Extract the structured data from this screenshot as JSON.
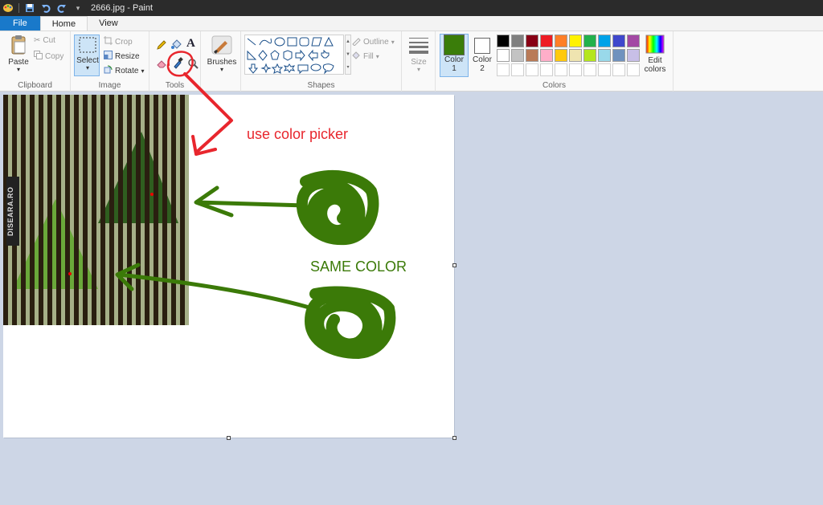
{
  "window": {
    "title": "2666.jpg - Paint"
  },
  "tabs": [
    "File",
    "Home",
    "View"
  ],
  "clipboard": {
    "paste": "Paste",
    "cut": "Cut",
    "copy": "Copy",
    "label": "Clipboard"
  },
  "image": {
    "select": "Select",
    "crop": "Crop",
    "resize": "Resize",
    "rotate": "Rotate",
    "label": "Image"
  },
  "tools": {
    "label": "Tools",
    "text_tool": "A"
  },
  "brushes": {
    "label": "Brushes"
  },
  "shapes": {
    "outline": "Outline",
    "fill": "Fill",
    "label": "Shapes"
  },
  "size": {
    "label": "Size"
  },
  "colors": {
    "color1_label": "Color",
    "color1_num": "1",
    "color2_label": "Color",
    "color2_num": "2",
    "edit_label_1": "Edit",
    "edit_label_2": "colors",
    "label": "Colors",
    "color1_value": "#3a7d0a",
    "color2_value": "#ffffff",
    "row1": [
      "#000000",
      "#7f7f7f",
      "#880015",
      "#ed1c24",
      "#ff7f27",
      "#fff200",
      "#22b14c",
      "#00a2e8",
      "#3f48cc",
      "#a349a4"
    ],
    "row2": [
      "#ffffff",
      "#c3c3c3",
      "#b97a57",
      "#ffaec9",
      "#ffc90e",
      "#efe4b0",
      "#b5e61d",
      "#99d9ea",
      "#7092be",
      "#c8bfe7"
    ]
  },
  "annotations": {
    "color_picker_note": "use color picker",
    "same_color_note": "SAME COLOR",
    "watermark": "DISEARA.RO",
    "red_color": "#e8262d",
    "green_color": "#3b7a08"
  }
}
